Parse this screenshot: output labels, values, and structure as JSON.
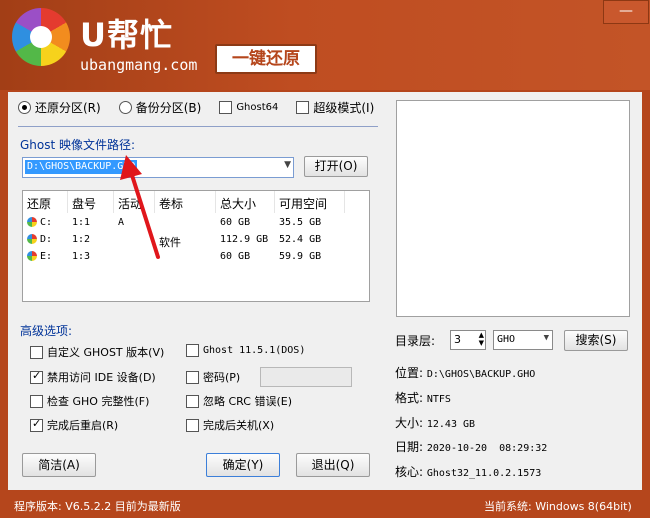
{
  "header": {
    "brand": "U帮忙",
    "domain": "ubangmang.com",
    "badge": "一键还原",
    "close_glyph": "—"
  },
  "mode": {
    "restore_label": "还原分区(R)",
    "backup_label": "备份分区(B)",
    "ghost64_label": "Ghost64",
    "super_label": "超级模式(I)",
    "restore_selected": true
  },
  "ghost_path": {
    "label": "Ghost 映像文件路径:",
    "value": "D:\\GHOS\\BACKUP.GHO",
    "open_button": "打开(O)"
  },
  "partition_table": {
    "columns": [
      "还原",
      "盘号",
      "活动",
      "卷标",
      "总大小",
      "可用空间"
    ],
    "rows": [
      {
        "drive": "C:",
        "disk": "1:1",
        "active": "A",
        "label": "",
        "total": "60 GB",
        "free": "35.5 GB"
      },
      {
        "drive": "D:",
        "disk": "1:2",
        "active": "",
        "label": "软件",
        "total": "112.9 GB",
        "free": "52.4 GB"
      },
      {
        "drive": "E:",
        "disk": "1:3",
        "active": "",
        "label": "",
        "total": "60 GB",
        "free": "59.9 GB"
      }
    ]
  },
  "advanced": {
    "title": "高级选项:",
    "custom_ghost": "自定义 GHOST 版本(V)",
    "disable_ide": "禁用访问 IDE 设备(D)",
    "check_gho": "检查 GHO 完整性(F)",
    "reboot_after": "完成后重启(R)",
    "ghost_version": "Ghost 11.5.1(DOS)",
    "password": "密码(P)",
    "ignore_crc": "忽略 CRC 错误(E)",
    "shutdown_after": "完成后关机(X)"
  },
  "buttons": {
    "simple": "简洁(A)",
    "ok": "确定(Y)",
    "exit": "退出(Q)"
  },
  "dir_level": {
    "label": "目录层:",
    "value": "3",
    "ext": "GHO",
    "search": "搜索(S)"
  },
  "file_info": {
    "location_label": "位置:",
    "location": "D:\\GHOS\\BACKUP.GHO",
    "format_label": "格式:",
    "format": "NTFS",
    "size_label": "大小:",
    "size": "12.43 GB",
    "date_label": "日期:",
    "date": "2020-10-20  08:29:32",
    "core_label": "核心:",
    "core": "Ghost32_11.0.2.1573"
  },
  "footer": {
    "version": "程序版本: V6.5.2.2  目前为最新版",
    "system": "当前系统: Windows 8(64bit)"
  },
  "colors": {
    "frame": "#b5461c",
    "accent_blue": "#003399",
    "annotation_arrow": "#e0161b"
  }
}
